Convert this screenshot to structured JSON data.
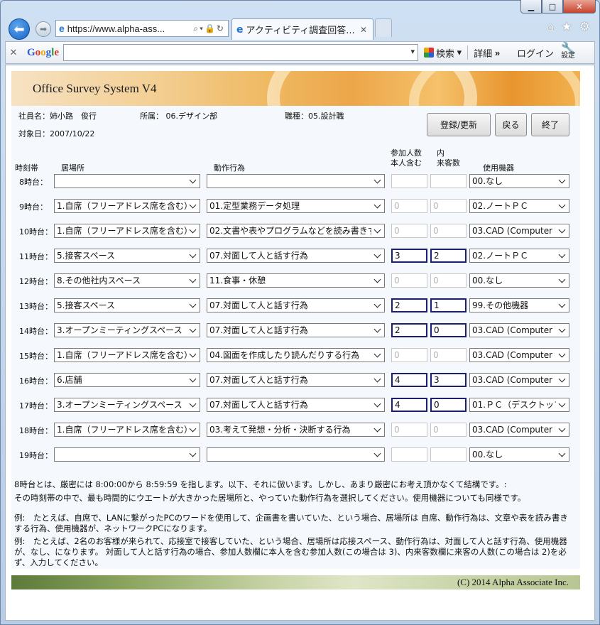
{
  "browser": {
    "address_url": "https://www.alpha-ass...",
    "tab_title": "アクティビティ調査回答...",
    "search_label": "検索",
    "more_label": "詳細",
    "login_label": "ログイン",
    "settings_label": "設定"
  },
  "app": {
    "title": "Office Survey System V4",
    "employee_label": "社員名：",
    "employee_name": "姉小路　俊行",
    "dept_label": "所属：",
    "dept_value": "06.デザイン部",
    "job_label": "職種：",
    "job_value": "05.設計職",
    "date_label": "対象日：",
    "date_value": "2007/10/22",
    "buttons": {
      "register": "登録/更新",
      "back": "戻る",
      "finish": "終了"
    }
  },
  "headers": {
    "time": "時刻帯",
    "place": "居場所",
    "action": "動作行為",
    "participants_1": "参加人数",
    "participants_2": "本人含む",
    "visitors_1": "内",
    "visitors_2": "来客数",
    "device": "使用機器"
  },
  "rows": [
    {
      "time": "8時台：",
      "place": "",
      "action": "",
      "participants": "",
      "visitors": "",
      "device": "00.なし",
      "state": "empty"
    },
    {
      "time": "9時台：",
      "place": "1.自席（フリーアドレス席を含む）",
      "action": "01.定型業務データ処理",
      "participants": "0",
      "visitors": "0",
      "device": "02.ノートＰＣ",
      "state": "disabled"
    },
    {
      "time": "10時台：",
      "place": "1.自席（フリーアドレス席を含む）",
      "action": "02.文書や表やプログラムなどを読み書きする行為",
      "participants": "0",
      "visitors": "0",
      "device": "03.CAD (Computer",
      "state": "disabled"
    },
    {
      "time": "11時台：",
      "place": "5.接客スペース",
      "action": "07.対面して人と話す行為",
      "participants": "3",
      "visitors": "2",
      "device": "02.ノートＰＣ",
      "state": "active"
    },
    {
      "time": "12時台：",
      "place": "8.その他社内スペース",
      "action": "11.食事・休憩",
      "participants": "0",
      "visitors": "0",
      "device": "00.なし",
      "state": "disabled"
    },
    {
      "time": "13時台：",
      "place": "5.接客スペース",
      "action": "07.対面して人と話す行為",
      "participants": "2",
      "visitors": "1",
      "device": "99.その他機器",
      "state": "active"
    },
    {
      "time": "14時台：",
      "place": "3.オープンミーティングスペース",
      "action": "07.対面して人と話す行為",
      "participants": "2",
      "visitors": "0",
      "device": "03.CAD (Computer",
      "state": "active"
    },
    {
      "time": "15時台：",
      "place": "1.自席（フリーアドレス席を含む）",
      "action": "04.図面を作成したり読んだりする行為",
      "participants": "0",
      "visitors": "0",
      "device": "03.CAD (Computer",
      "state": "disabled"
    },
    {
      "time": "16時台：",
      "place": "6.店舗",
      "action": "07.対面して人と話す行為",
      "participants": "4",
      "visitors": "3",
      "device": "03.CAD (Computer",
      "state": "active"
    },
    {
      "time": "17時台：",
      "place": "3.オープンミーティングスペース",
      "action": "07.対面して人と話す行為",
      "participants": "4",
      "visitors": "0",
      "device": "01.ＰＣ（デスクトップ",
      "state": "active"
    },
    {
      "time": "18時台：",
      "place": "1.自席（フリーアドレス席を含む）",
      "action": "03.考えて発想・分析・決断する行為",
      "participants": "0",
      "visitors": "0",
      "device": "03.CAD (Computer",
      "state": "disabled"
    },
    {
      "time": "19時台：",
      "place": "",
      "action": "",
      "participants": "",
      "visitors": "",
      "device": "00.なし",
      "state": "empty"
    }
  ],
  "notes": {
    "n1": "8時台とは、厳密には 8:00:00から 8:59:59 を指します。以下、それに倣います。しかし、あまり厳密にお考え頂かなくて結構です。:",
    "n2": "その時刻帯の中で、最も時間的にウエートが大きかった居場所と、やっていた動作行為を選択してください。使用機器についても同様です。",
    "n3": "例:　たとえば、自席で、LANに繋がったPCのワードを使用して、企画書を書いていた、という場合、居場所は 自席、動作行為は、文章や表を読み書きする行為、使用機器が、ネットワークPCになります。",
    "n4": "例:　たとえば、2名のお客様が来られて、応接室で接客していた、という場合、居場所は応接スペース、動作行為は、対面して人と話す行為、使用機器が、なし、になります。 対面して人と話す行為の場合、参加人数欄に本人を含む参加人数(この場合は 3)、内来客数欄に来客の人数(この場合は 2)を必ず、入力してください。"
  },
  "footer": {
    "copyright": "(C) 2014 Alpha Associate Inc."
  }
}
